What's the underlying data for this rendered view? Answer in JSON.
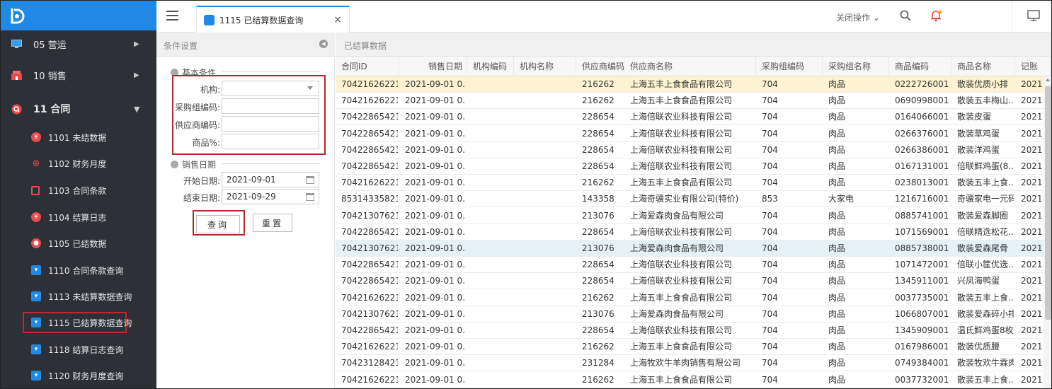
{
  "sidebar": {
    "groups": [
      {
        "label": "05 营运",
        "icon": "monitor-icon"
      },
      {
        "label": "10 销售",
        "icon": "shop-icon"
      },
      {
        "label": "11 合同",
        "icon": "search-badge-icon"
      }
    ],
    "items": [
      {
        "label": "1101 未结数据",
        "icon": "coin-icon",
        "color": "#e94b4b"
      },
      {
        "label": "1102 财务月度",
        "icon": "zoom-icon",
        "color": "#e94b4b"
      },
      {
        "label": "1103 合同条款",
        "icon": "clipboard-icon",
        "color": "#e94b4b"
      },
      {
        "label": "1104 结算日志",
        "icon": "coin-icon",
        "color": "#e94b4b"
      },
      {
        "label": "1105 已结数据",
        "icon": "zoom-icon",
        "color": "#e94b4b"
      },
      {
        "label": "1110 合同条款查询",
        "icon": "cart-icon",
        "color": "#1f89e5"
      },
      {
        "label": "1113 未结算数据查询",
        "icon": "cart-icon",
        "color": "#1f89e5"
      },
      {
        "label": "1115 已结算数据查询",
        "icon": "cart-icon",
        "color": "#1f89e5"
      },
      {
        "label": "1118 结算日志查询",
        "icon": "cart-icon",
        "color": "#1f89e5"
      },
      {
        "label": "1120 财务月度查询",
        "icon": "cart-icon",
        "color": "#1f89e5"
      }
    ]
  },
  "topbar": {
    "tab_label": "1115 已结算数据查询",
    "tab_close": "×",
    "close_ops": "关闭操作 ⌄"
  },
  "conditions": {
    "panel_title": "条件设置",
    "basic_title": "基本条件",
    "fields": [
      {
        "label": "机构:",
        "value": ""
      },
      {
        "label": "采购组编码:",
        "value": ""
      },
      {
        "label": "供应商编码:",
        "value": ""
      },
      {
        "label": "商品%:",
        "value": ""
      }
    ],
    "date_title": "销售日期",
    "start_label": "开始日期:",
    "start_value": "2021-09-01",
    "end_label": "结束日期:",
    "end_value": "2021-09-29",
    "query_btn": "查询",
    "reset_btn": "重置"
  },
  "data": {
    "panel_title": "已结算数据",
    "columns": [
      "合同ID",
      "销售日期",
      "机构编码",
      "机构名称",
      "供应商编码",
      "供应商名称",
      "采购组编码",
      "采购组名称",
      "商品编码",
      "商品名称",
      "记账"
    ],
    "rows": [
      [
        "70421626221...",
        "2021-09-01 0...",
        "",
        "",
        "216262",
        "上海五丰上食食品有限公司",
        "704",
        "肉品",
        "0222726001",
        "散装优质小排",
        "2021"
      ],
      [
        "70421626221...",
        "2021-09-01 0...",
        "",
        "",
        "216262",
        "上海五丰上食食品有限公司",
        "704",
        "肉品",
        "0690998001",
        "散装五丰梅山...",
        "2021"
      ],
      [
        "70422865421...",
        "2021-09-01 0...",
        "",
        "",
        "228654",
        "上海倍联农业科技有限公司",
        "704",
        "肉品",
        "0164066001",
        "散装皮蛋",
        "2021"
      ],
      [
        "70422865421...",
        "2021-09-01 0...",
        "",
        "",
        "228654",
        "上海倍联农业科技有限公司",
        "704",
        "肉品",
        "0266376001",
        "散装草鸡蛋",
        "2021"
      ],
      [
        "70422865421...",
        "2021-09-01 0...",
        "",
        "",
        "228654",
        "上海倍联农业科技有限公司",
        "704",
        "肉品",
        "0266386001",
        "散装洋鸡蛋",
        "2021"
      ],
      [
        "70422865421...",
        "2021-09-01 0...",
        "",
        "",
        "228654",
        "上海倍联农业科技有限公司",
        "704",
        "肉品",
        "0167131001",
        "倍联鲜鸡蛋(8...",
        "2021"
      ],
      [
        "70421626221...",
        "2021-09-01 0...",
        "",
        "",
        "216262",
        "上海五丰上食食品有限公司",
        "704",
        "肉品",
        "0238013001",
        "散装五丰上食...",
        "2021"
      ],
      [
        "85314335821...",
        "2021-09-01 0...",
        "",
        "",
        "143358",
        "上海奇骥实业有限公司(特价)",
        "853",
        "大家电",
        "1216716001",
        "奇骥家电一元码",
        "2021"
      ],
      [
        "70421307621...",
        "2021-09-01 0...",
        "",
        "",
        "213076",
        "上海爱森肉食品有限公司",
        "704",
        "肉品",
        "0885741001",
        "散装爱森脚圈",
        "2021"
      ],
      [
        "70422865421...",
        "2021-09-01 0...",
        "",
        "",
        "228654",
        "上海倍联农业科技有限公司",
        "704",
        "肉品",
        "1071569001",
        "倍联精选松花...",
        "2021"
      ],
      [
        "70421307621...",
        "2021-09-01 0...",
        "",
        "",
        "213076",
        "上海爱森肉食品有限公司",
        "704",
        "肉品",
        "0885738001",
        "散装爱森尾骨",
        "2021"
      ],
      [
        "70422865421...",
        "2021-09-01 0...",
        "",
        "",
        "228654",
        "上海倍联农业科技有限公司",
        "704",
        "肉品",
        "1071472001",
        "倍联小筐优选...",
        "2021"
      ],
      [
        "70422865421...",
        "2021-09-01 0...",
        "",
        "",
        "228654",
        "上海倍联农业科技有限公司",
        "704",
        "肉品",
        "1345911001",
        "兴凤海鸭蛋",
        "2021"
      ],
      [
        "70421626221...",
        "2021-09-01 0...",
        "",
        "",
        "216262",
        "上海五丰上食食品有限公司",
        "704",
        "肉品",
        "0037735001",
        "散装五丰上食...",
        "2021"
      ],
      [
        "70421307621...",
        "2021-09-01 0...",
        "",
        "",
        "213076",
        "上海爱森肉食品有限公司",
        "704",
        "肉品",
        "1066807001",
        "散装爱森碎小排",
        "2021"
      ],
      [
        "70422865421...",
        "2021-09-01 0...",
        "",
        "",
        "228654",
        "上海倍联农业科技有限公司",
        "704",
        "肉品",
        "1345909001",
        "温氏鲜鸡蛋8枚...",
        "2021"
      ],
      [
        "70421626221...",
        "2021-09-01 0...",
        "",
        "",
        "216262",
        "上海五丰上食食品有限公司",
        "704",
        "肉品",
        "0167986001",
        "散装优质腰",
        "2021"
      ],
      [
        "70423128421...",
        "2021-09-01 0...",
        "",
        "",
        "231284",
        "上海牧欢牛羊肉销售有限公司",
        "704",
        "肉品",
        "0749384001",
        "散装牧欢牛霖肉",
        "2021"
      ],
      [
        "70421626221...",
        "2021-09-01 0...",
        "",
        "",
        "216262",
        "上海五丰上食食品有限公司",
        "704",
        "肉品",
        "0037732001",
        "散装五丰上食...",
        "2021"
      ]
    ]
  },
  "colors": {
    "accent": "#1f89e5",
    "sidebar_bg": "#2d3137",
    "highlight": "#b3282d",
    "selected_row": "#fdf3d0"
  }
}
